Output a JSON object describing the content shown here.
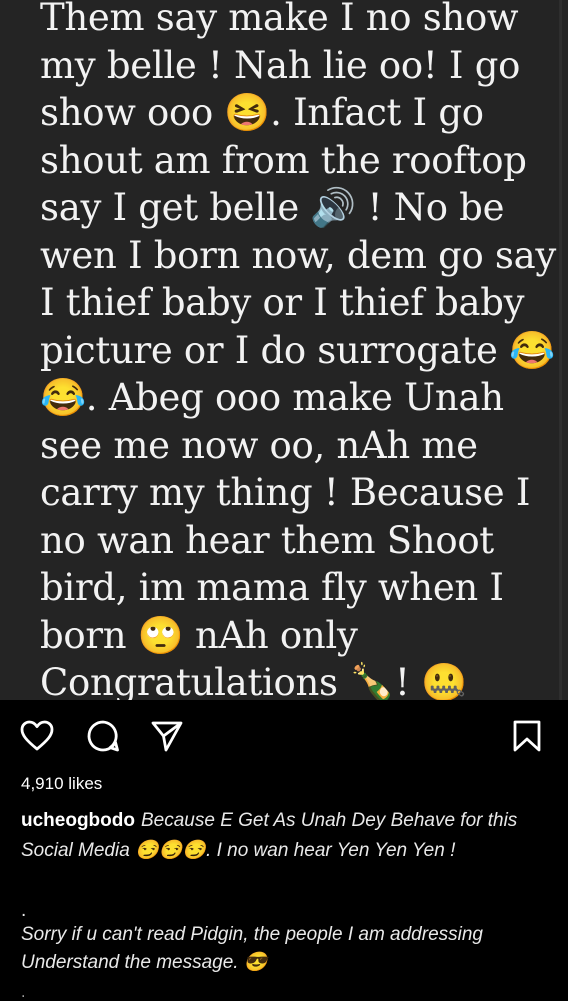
{
  "post": {
    "image_text": "Them say make I no show my belle ! Nah lie oo! I go show ooo 😆. Infact I go shout am from the rooftop say I get belle 🔊 ! No be wen I born now, dem go say I thief baby or I thief baby picture or I do surrogate 😂 😂. Abeg ooo make Unah see me now oo, nAh me carry my thing ! Because I no wan hear them Shoot bird, im mama fly when I born 🙄 nAh only Congratulations 🍾! 🤐"
  },
  "actions": {
    "like_icon": "heart-icon",
    "comment_icon": "comment-icon",
    "share_icon": "paper-plane-icon",
    "save_icon": "bookmark-icon"
  },
  "likes": "4,910 likes",
  "caption": {
    "username": "ucheogbodo",
    "text": "Because E Get As Unah Dey Behave for this Social Media 😏😏😏. I no wan hear Yen Yen Yen !",
    "separator": ".",
    "extra": "Sorry if u can't read Pidgin, the people I am addressing Understand the message. 😎",
    "more": "."
  },
  "colors": {
    "post_background": "#242424",
    "app_background": "#000000",
    "text": "#ffffff"
  }
}
